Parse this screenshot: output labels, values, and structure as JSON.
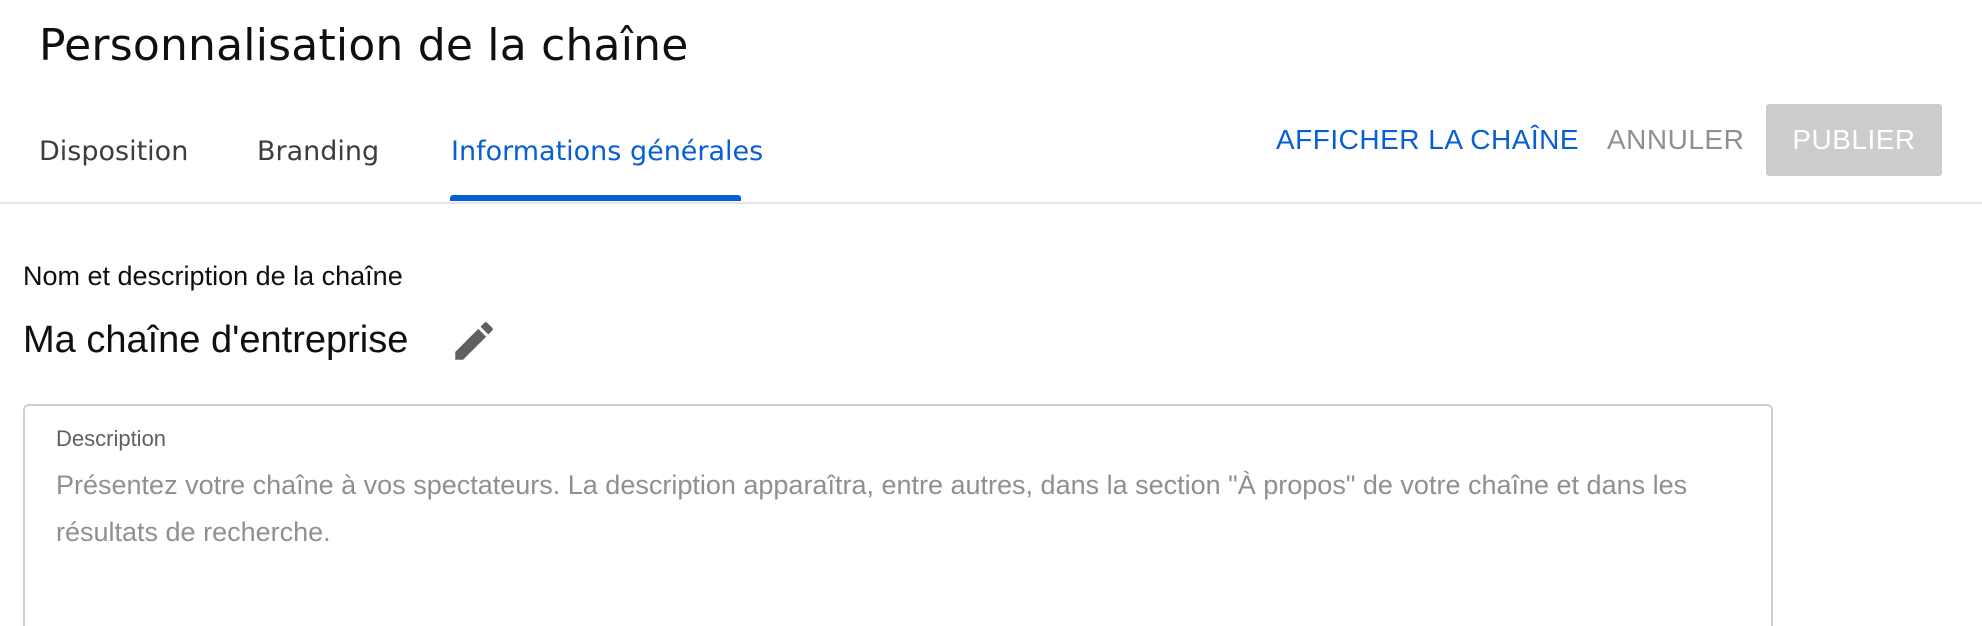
{
  "header": {
    "title": "Personnalisation de la chaîne"
  },
  "tabs": [
    {
      "label": "Disposition",
      "active": false
    },
    {
      "label": "Branding",
      "active": false
    },
    {
      "label": "Informations générales",
      "active": true
    }
  ],
  "actions": {
    "view_channel": "AFFICHER LA CHAÎNE",
    "cancel": "ANNULER",
    "publish": "PUBLIER",
    "publish_enabled": false
  },
  "section": {
    "label": "Nom et description de la chaîne",
    "channel_name": "Ma chaîne d'entreprise",
    "edit_icon": "pencil-icon"
  },
  "description": {
    "label": "Description",
    "placeholder": "Présentez votre chaîne à vos spectateurs. La description apparaîtra, entre autres, dans la section \"À propos\" de votre chaîne et dans les résultats de recherche.",
    "value": ""
  },
  "colors": {
    "accent": "#065fd4",
    "disabled_button_bg": "#cccccc",
    "muted_text": "#909090",
    "divider": "#e5e5e5"
  }
}
